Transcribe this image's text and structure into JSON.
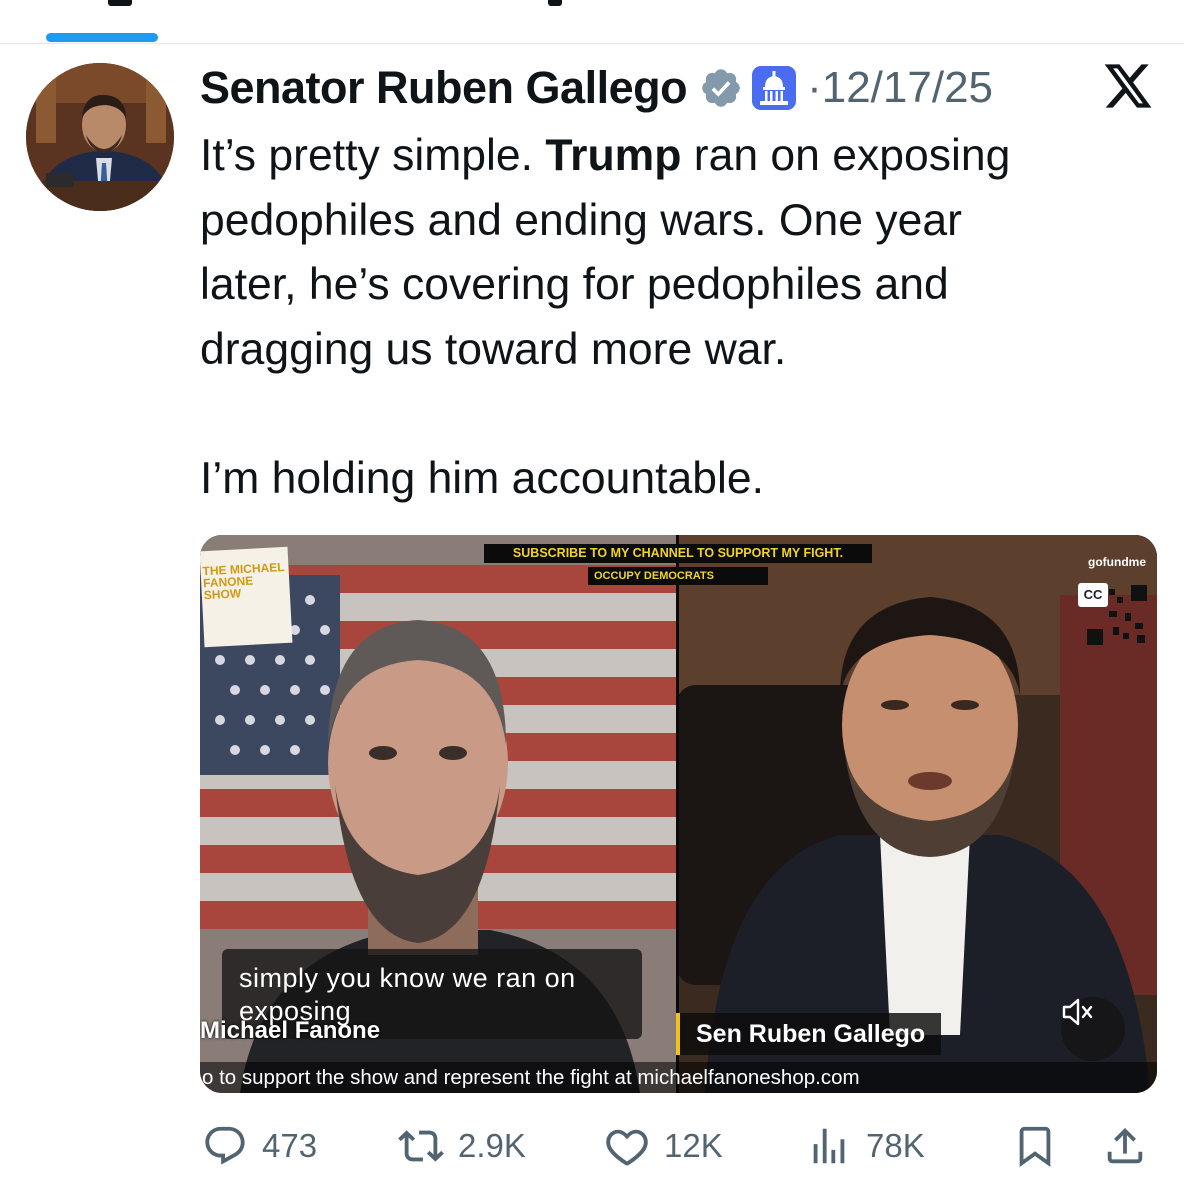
{
  "post": {
    "author_name": "Senator Ruben Gallego",
    "separator": "·",
    "date": "12/17/25",
    "text_lines": [
      [
        "It’s pretty simple. ",
        "Trump",
        " ran on exposing"
      ],
      "pedophiles and ending wars. One year",
      "later, he’s covering for pedophiles and",
      "dragging us toward more war.",
      "",
      "I’m holding him accountable."
    ]
  },
  "icons": {
    "verified": "verified-badge-icon",
    "government": "capitol-building-icon",
    "platform": "x-logo-icon",
    "reply": "reply-icon",
    "repost": "repost-icon",
    "like": "heart-icon",
    "views": "views-icon",
    "bookmark": "bookmark-icon",
    "share": "share-icon",
    "mute": "muted-speaker-icon"
  },
  "video": {
    "banner": "SUBSCRIBE TO MY CHANNEL TO SUPPORT MY FIGHT.",
    "occupy_logo": "OCCUPY DEMOCRATS",
    "show_logo": "THE MICHAEL FANONE SHOW",
    "gofundme": "gofundme",
    "cc": "CC",
    "caption": "simply you know we ran on exposing",
    "left_name": "Michael Fanone",
    "right_name": "Sen Ruben Gallego",
    "ticker": "o to support the show and represent the fight at michaelfanoneshop.com"
  },
  "actions": {
    "replies": "473",
    "reposts": "2.9K",
    "likes": "12K",
    "views": "78K"
  },
  "colors": {
    "accent": "#1d9bf0",
    "text": "#0f1419",
    "secondary": "#536471",
    "lower_third_accent": "#f2c21b"
  }
}
